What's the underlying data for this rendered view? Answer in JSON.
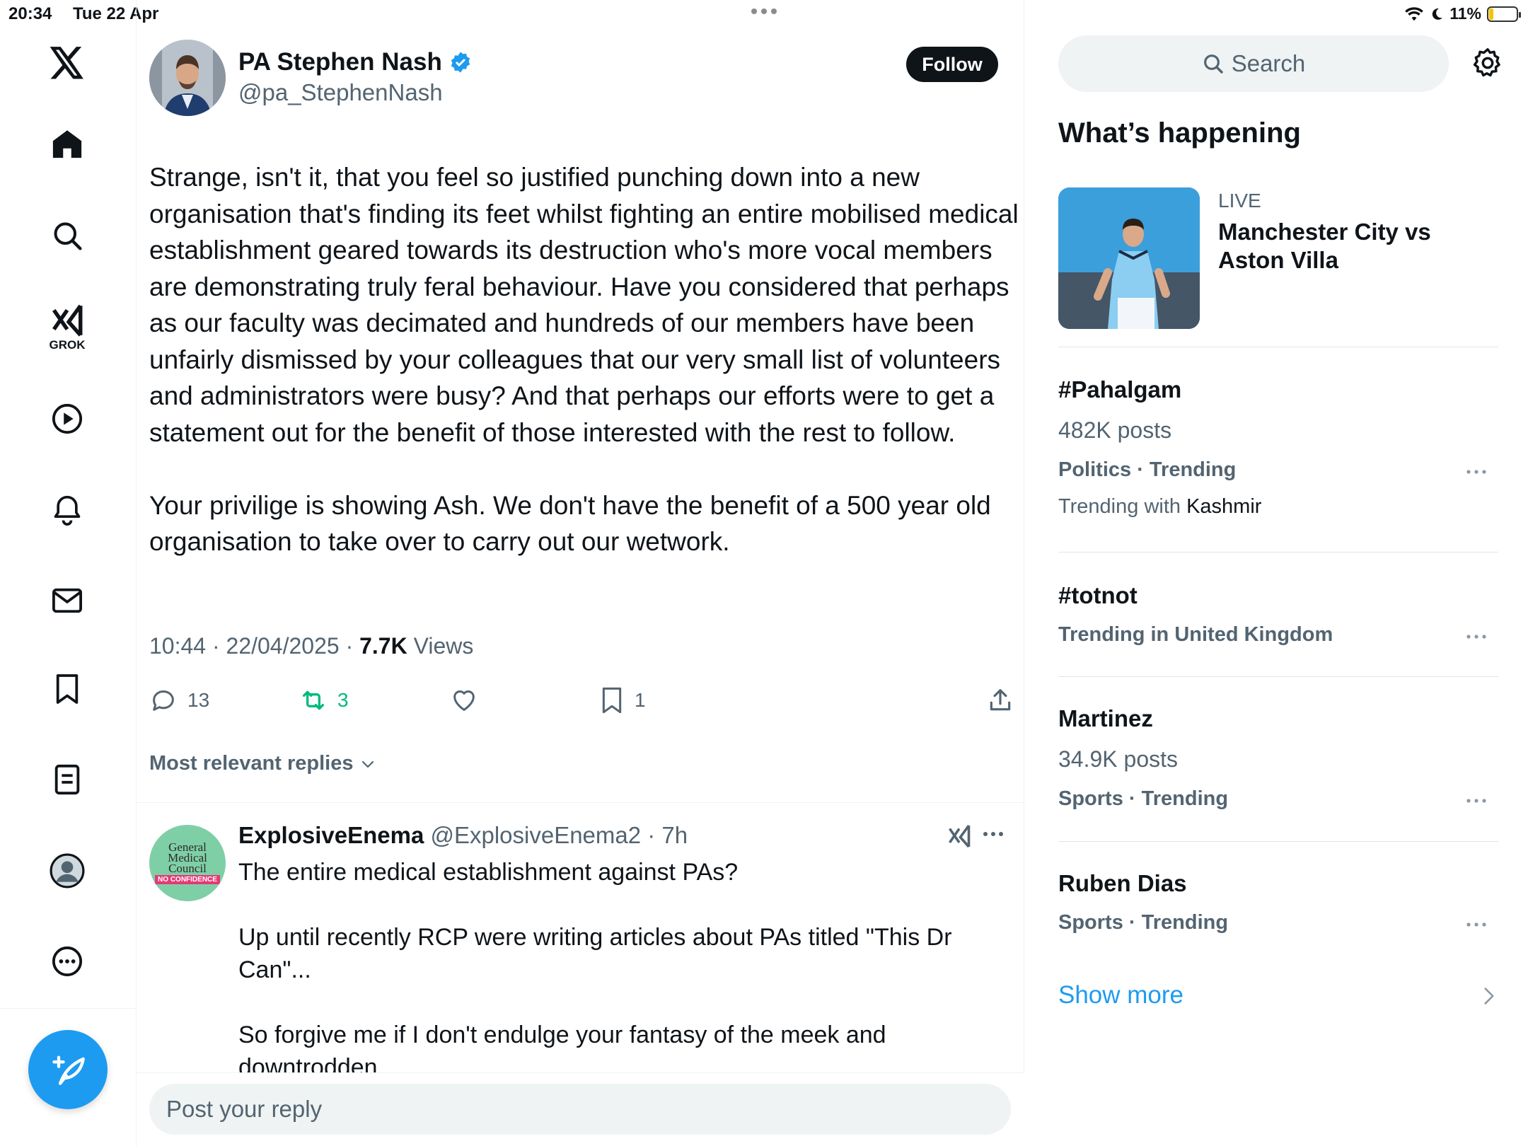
{
  "status_bar": {
    "time": "20:34",
    "date": "Tue 22 Apr",
    "battery": "11%"
  },
  "nav": {
    "items": [
      {
        "name": "x-logo-icon"
      },
      {
        "name": "home-icon"
      },
      {
        "name": "search-icon"
      },
      {
        "name": "grok-icon",
        "label": "GROK"
      },
      {
        "name": "video-icon"
      },
      {
        "name": "notifications-icon"
      },
      {
        "name": "messages-icon"
      },
      {
        "name": "bookmarks-icon"
      },
      {
        "name": "lists-icon"
      },
      {
        "name": "profile-icon"
      },
      {
        "name": "more-icon"
      }
    ],
    "grok_label": "GROK"
  },
  "tweet": {
    "author_name": "PA Stephen Nash",
    "author_handle": "@pa_StephenNash",
    "follow_label": "Follow",
    "paragraphs": [
      "Strange, isn't it, that you feel so justified punching down into a new organisation that's finding its feet whilst fighting an entire mobilised medical establishment geared towards its destruction who's more vocal members are demonstrating truly feral behaviour. Have you considered that perhaps as our faculty was decimated and hundreds of our members have been unfairly dismissed by your colleagues that our very small list of volunteers and administrators were busy? And that perhaps our efforts were to get a statement out for the benefit of those interested with the rest to follow.",
      "Your privilige is showing Ash. We don't have the benefit of a 500 year old organisation to take over to carry out our wetwork."
    ],
    "time_date": "10:44 · 22/04/2025 · ",
    "views_count": "7.7K",
    "views_label": " Views",
    "replies": "13",
    "reposts": "3",
    "bookmarks": "1",
    "sort_label": "Most relevant replies"
  },
  "reply": {
    "name": "ExplosiveEnema",
    "meta": " @ExplosiveEnema2 · 7h",
    "avatar_text": "General Medical Council",
    "avatar_stamp": "NO CONFIDENCE",
    "paragraphs": [
      "The entire medical establishment against PAs?",
      "Up until recently RCP were writing articles about PAs titled \"This Dr Can\"...",
      "So forgive me if I don't endulge your fantasy of the meek and downtrodden"
    ],
    "input_placeholder": "Post your reply"
  },
  "sidebar": {
    "search_placeholder": "Search",
    "section_title": "What’s happening",
    "live": {
      "label": "LIVE",
      "title": "Manchester City vs Aston Villa"
    },
    "trends": [
      {
        "title": "#Pahalgam",
        "posts": "482K posts",
        "category": "Politics · Trending",
        "with_prefix": "Trending with ",
        "with": "Kashmir"
      },
      {
        "title": "#totnot",
        "category": "Trending in United Kingdom"
      },
      {
        "title": "Martinez",
        "posts": "34.9K posts",
        "category": "Sports · Trending"
      },
      {
        "title": "Ruben Dias",
        "category": "Sports · Trending"
      }
    ],
    "show_more": "Show more"
  },
  "colors": {
    "accent": "#1d9bf0",
    "repost": "#00ba7c",
    "text": "#0f1419",
    "muted": "#536471"
  }
}
